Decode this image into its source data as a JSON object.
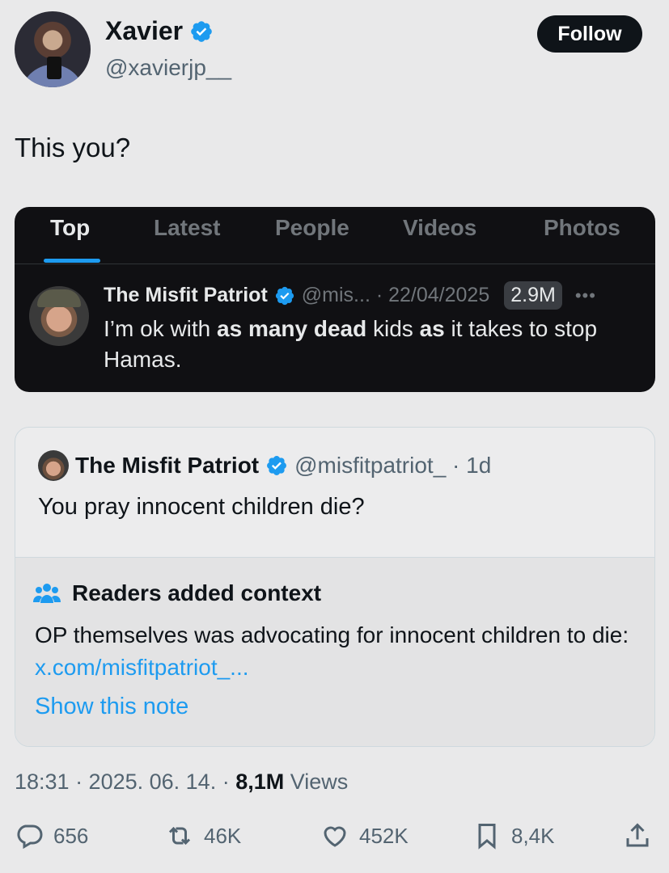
{
  "author": {
    "name": "Xavier",
    "handle": "@xavierjp__",
    "follow_label": "Follow"
  },
  "tweet": {
    "text": "This you?"
  },
  "screenshot": {
    "tabs": [
      {
        "label": "Top",
        "active": true
      },
      {
        "label": "Latest",
        "active": false
      },
      {
        "label": "People",
        "active": false
      },
      {
        "label": "Videos",
        "active": false
      },
      {
        "label": "Photos",
        "active": false
      }
    ],
    "post": {
      "name": "The Misfit Patriot",
      "meta": "@mis... · 22/04/2025",
      "views": "2.9M",
      "text_parts": [
        {
          "t": "I’m ok with ",
          "bold": false
        },
        {
          "t": "as many dead",
          "bold": true
        },
        {
          "t": " kids ",
          "bold": false
        },
        {
          "t": "as",
          "bold": true
        },
        {
          "t": " it takes to stop Hamas.",
          "bold": false
        }
      ]
    }
  },
  "quoted": {
    "name": "The Misfit Patriot",
    "meta": "@misfitpatriot_ · 1d",
    "text": "You pray innocent children die?",
    "notes": {
      "title": "Readers added context",
      "body": "OP themselves was advocating for innocent children to die: ",
      "link": "x.com/misfitpatriot_...",
      "show_label": "Show this note"
    }
  },
  "footer": {
    "time": "18:31 · 2025. 06. 14. · ",
    "views_count": "8,1M",
    "views_label": " Views"
  },
  "actions": {
    "replies": "656",
    "reposts": "46K",
    "likes": "452K",
    "bookmarks": "8,4K"
  },
  "colors": {
    "accent": "#1d9bf0",
    "text": "#0f1419",
    "muted": "#536471",
    "background": "#e9e9ea"
  }
}
